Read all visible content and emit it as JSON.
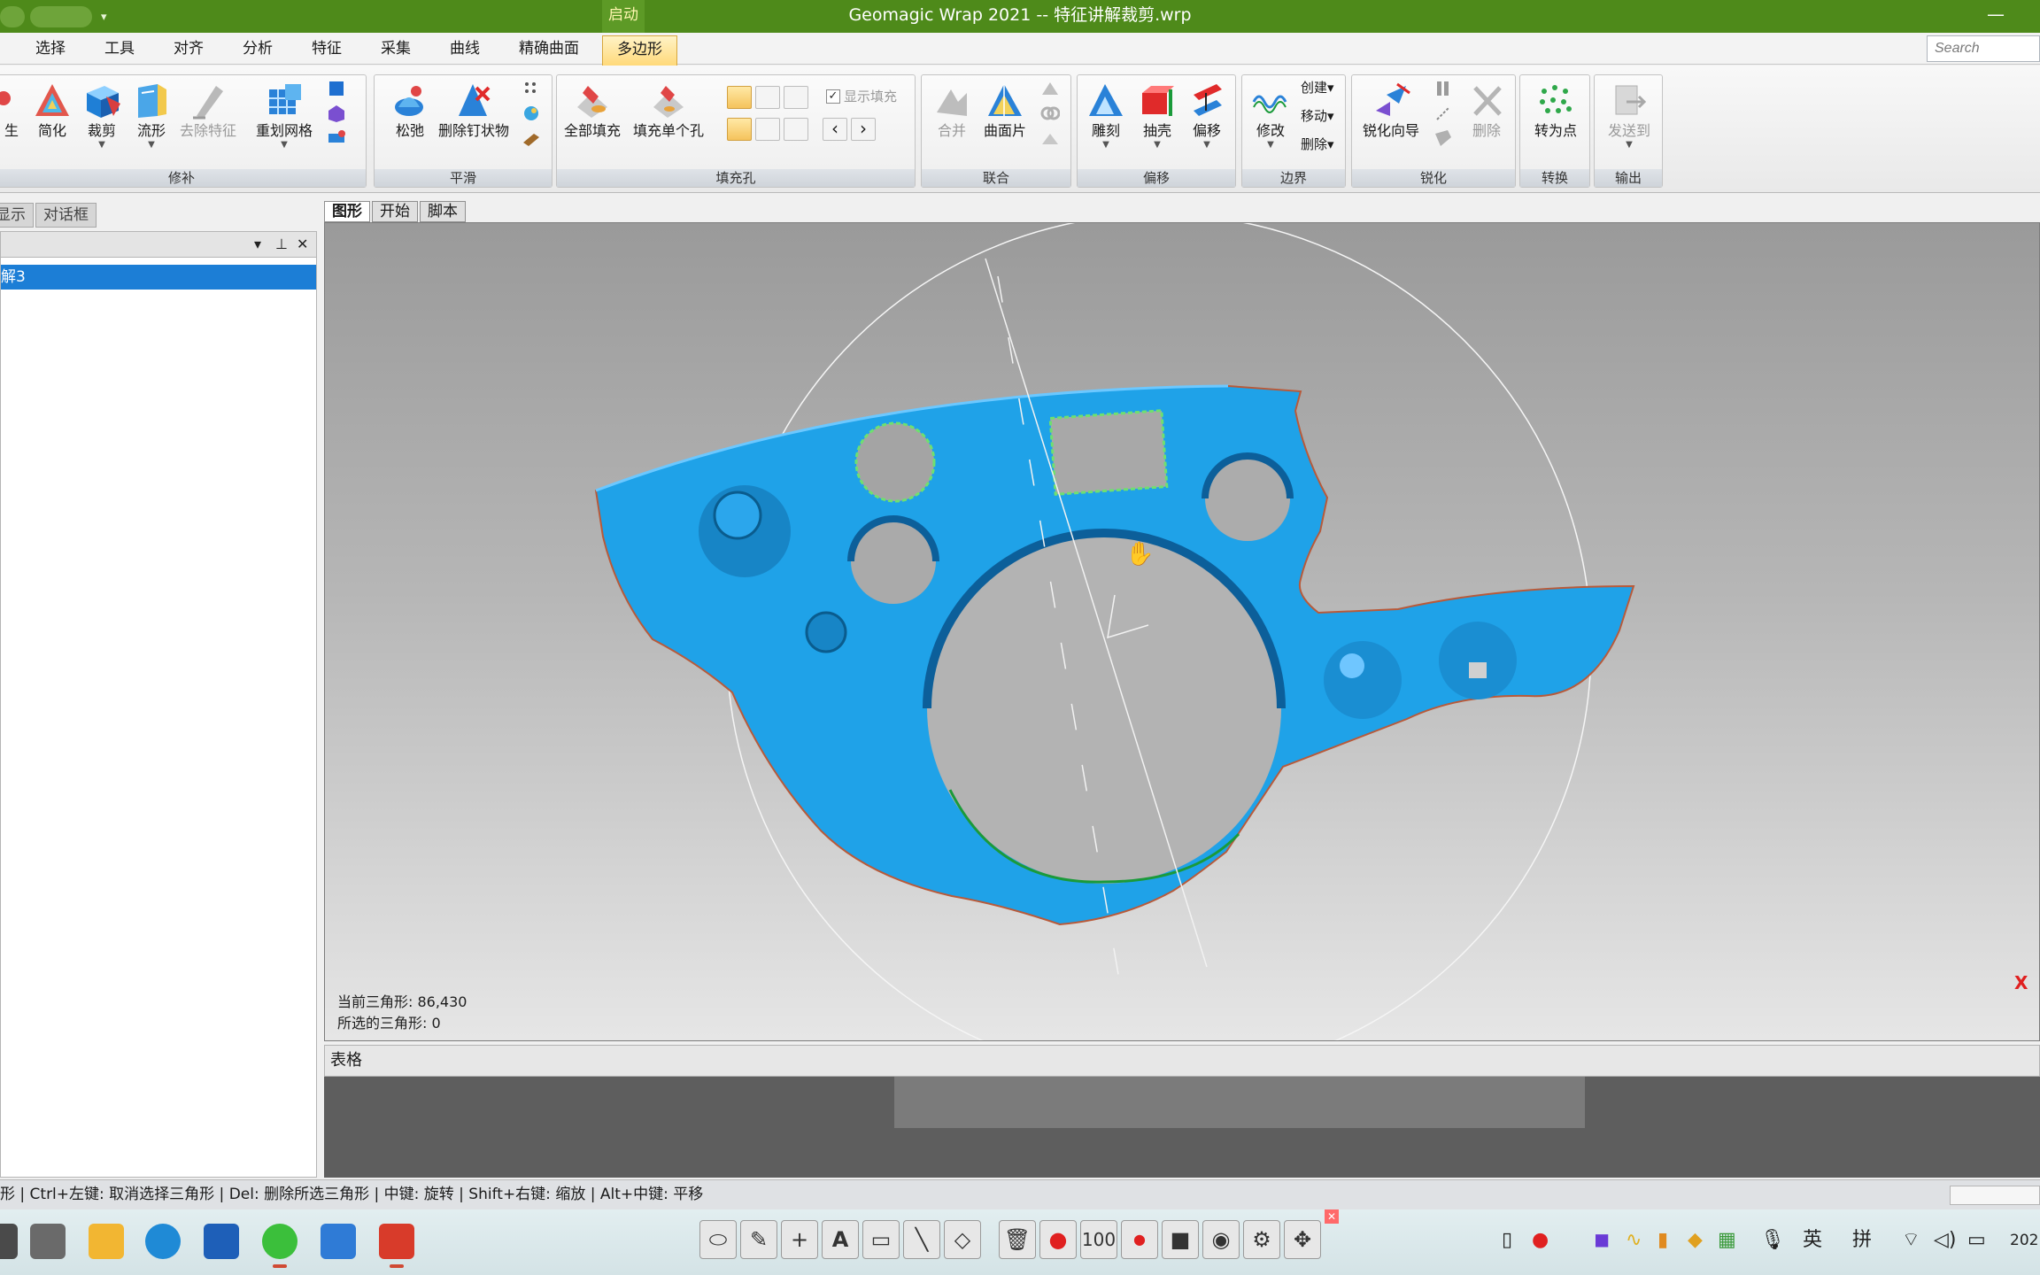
{
  "titlebar": {
    "context_tab": "启动",
    "title": "Geomagic Wrap 2021 -- 特征讲解裁剪.wrp",
    "minimize": "—"
  },
  "menu": {
    "tabs": [
      "选择",
      "工具",
      "对齐",
      "分析",
      "特征",
      "采集",
      "曲线",
      "精确曲面",
      "多边形"
    ],
    "active_tab": "多边形",
    "search_placeholder": "Search"
  },
  "ribbon": {
    "groups": {
      "repair": "修补",
      "smooth": "平滑",
      "fill": "填充孔",
      "union": "联合",
      "offset": "偏移",
      "boundary": "边界",
      "sharpen": "锐化",
      "convert": "转换",
      "output": "输出"
    },
    "tools": {
      "generate": "生",
      "simplify": "简化",
      "trim": "裁剪",
      "manifold": "流形",
      "remove_feature": "去除特征",
      "remesh": "重划网格",
      "relax": "松弛",
      "remove_spikes": "删除钉状物",
      "fill_all": "全部填充",
      "fill_single": "填充单个孔",
      "show_fill": "显示填充",
      "merge": "合并",
      "patch": "曲面片",
      "carve": "雕刻",
      "extrude": "抽壳",
      "offset": "偏移",
      "modify": "修改",
      "create": "创建",
      "move": "移动",
      "delete": "删除",
      "sharpen_wizard": "锐化向导",
      "sharpen_delete": "删除",
      "to_points": "转为点",
      "send_to": "发送到"
    }
  },
  "left_panel": {
    "tabs": [
      "显示",
      "对话框"
    ],
    "selected_item": "解3"
  },
  "viewport": {
    "tabs": [
      "图形",
      "开始",
      "脚本"
    ],
    "active_tab": "图形",
    "current_triangles": "当前三角形: 86,430",
    "selected_triangles": "所选的三角形: 0",
    "axis_label": "X"
  },
  "table_panel": {
    "title": "表格"
  },
  "statusbar": {
    "text": "形 | Ctrl+左键: 取消选择三角形 | Del: 删除所选三角形 | 中键: 旋转 | Shift+右键: 缩放 | Alt+中键: 平移"
  },
  "taskbar": {
    "toolbar_counter": "100",
    "lang_en": "英",
    "lang_pinyin": "拼",
    "clock": "202"
  },
  "colors": {
    "titlebar": "#4e8a1a",
    "mesh": "#1fa2e8",
    "selection": "#1c7ed6",
    "active_tab": "#ffd97a"
  }
}
